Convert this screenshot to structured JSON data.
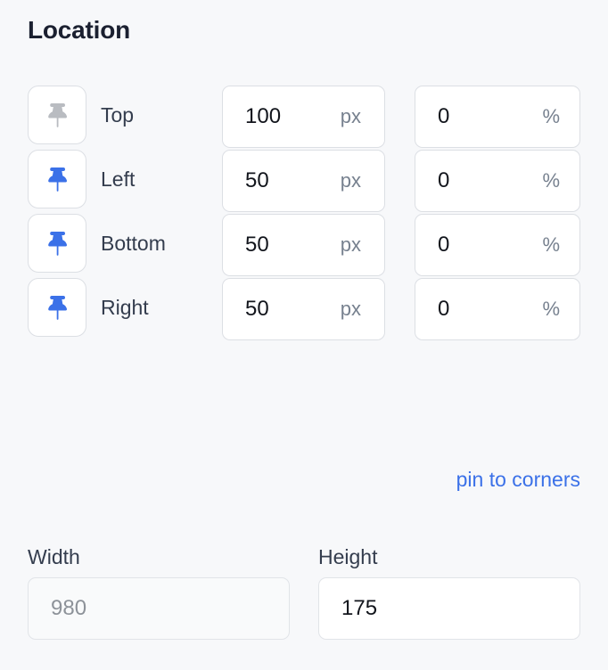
{
  "section": {
    "title": "Location"
  },
  "colors": {
    "background": "#f7f8fa",
    "heading": "#1b2030",
    "label": "#343d4e",
    "accent_blue": "#3b71e8",
    "pin_inactive": "#b9bcc1",
    "unit_text": "#77818f",
    "placeholder": "#8d9299",
    "value_text": "#12151c",
    "field_border": "#dcdfe4"
  },
  "rows": [
    {
      "label": "Top",
      "pin_icon": "pushpin-icon",
      "pin_active": false,
      "px_value": "100",
      "px_unit": "px",
      "pct_value": "0",
      "pct_unit": "%"
    },
    {
      "label": "Left",
      "pin_icon": "pushpin-icon",
      "pin_active": true,
      "px_value": "50",
      "px_unit": "px",
      "pct_value": "0",
      "pct_unit": "%"
    },
    {
      "label": "Bottom",
      "pin_icon": "pushpin-icon",
      "pin_active": true,
      "px_value": "50",
      "px_unit": "px",
      "pct_value": "0",
      "pct_unit": "%"
    },
    {
      "label": "Right",
      "pin_icon": "pushpin-icon",
      "pin_active": true,
      "px_value": "50",
      "px_unit": "px",
      "pct_value": "0",
      "pct_unit": "%"
    }
  ],
  "pin_to_corners": {
    "label": "pin to corners"
  },
  "size": {
    "width": {
      "label": "Width",
      "value": "",
      "placeholder": "980",
      "disabled": true
    },
    "height": {
      "label": "Height",
      "value": "175",
      "placeholder": "",
      "disabled": false
    }
  }
}
